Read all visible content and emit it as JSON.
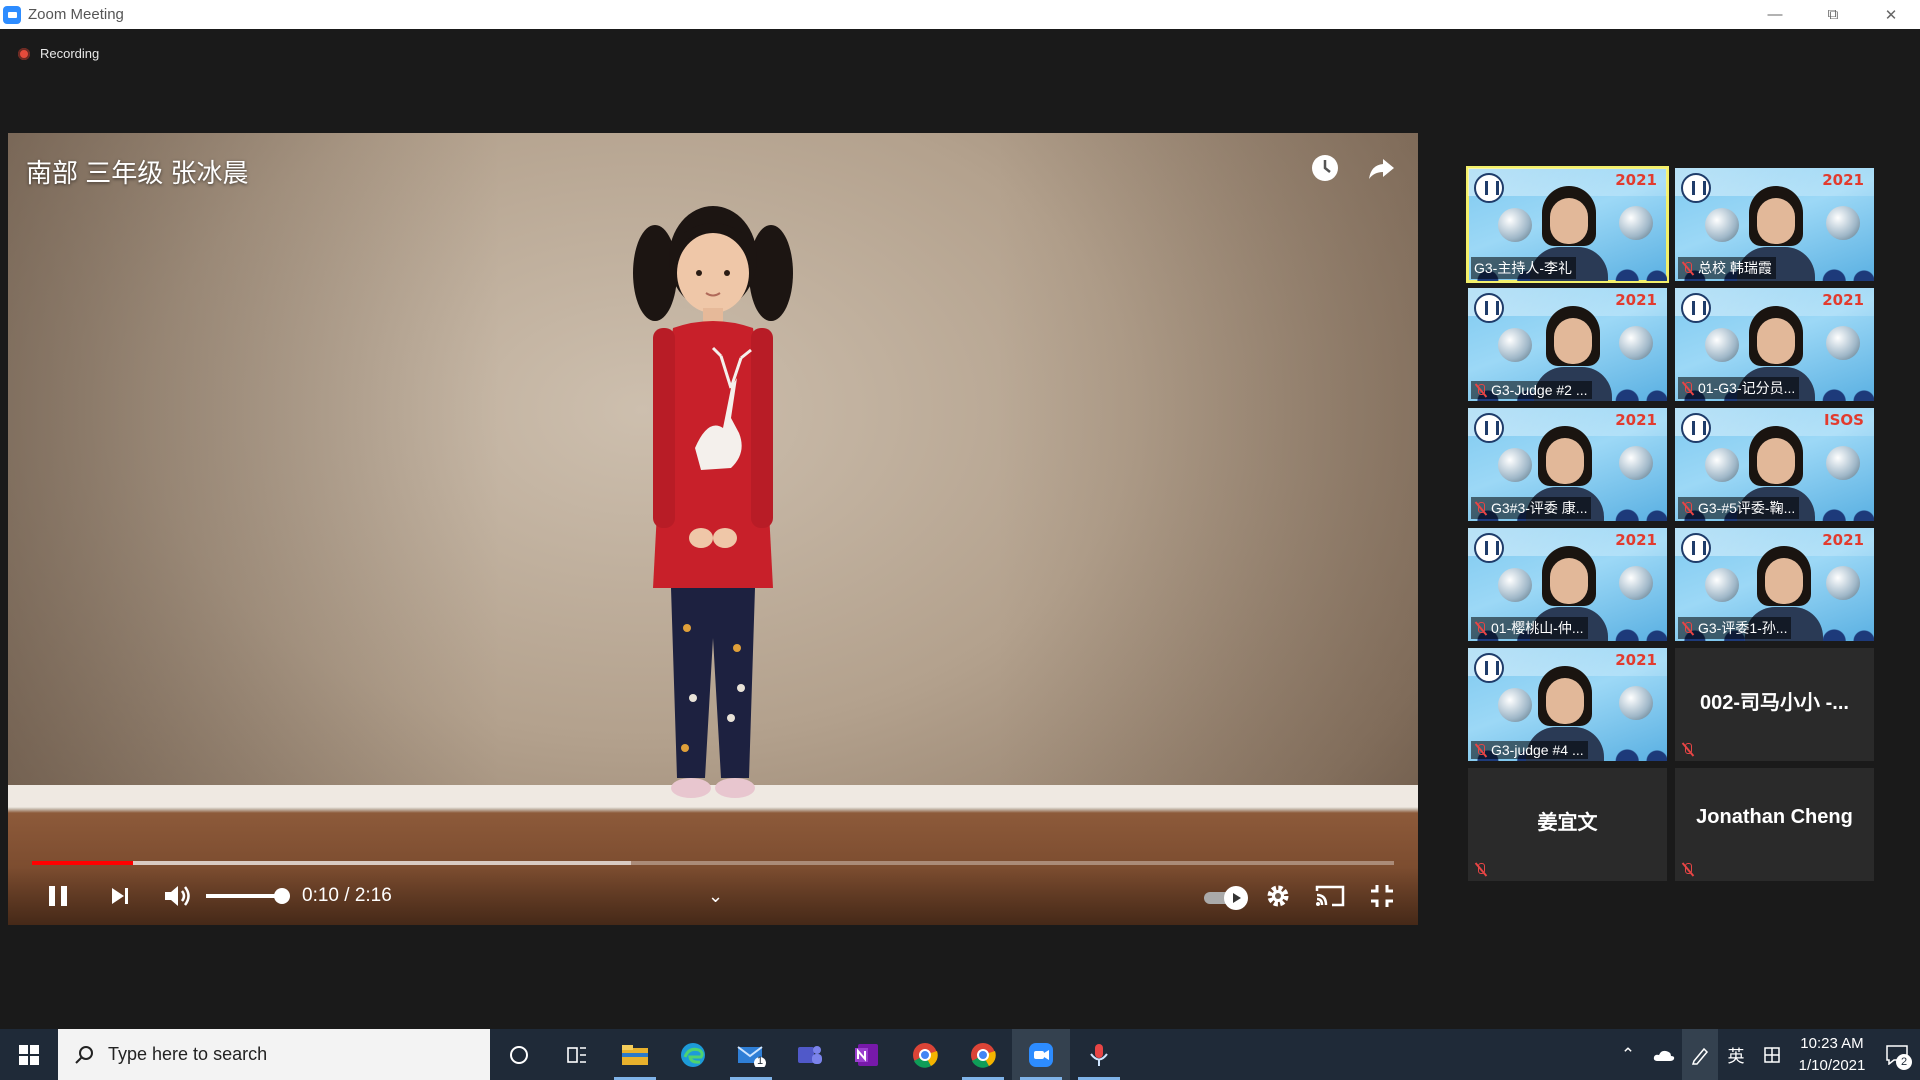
{
  "window": {
    "title": "Zoom Meeting"
  },
  "meeting": {
    "recording_label": "Recording"
  },
  "video": {
    "title": "南部 三年级 张冰晨",
    "time_current": "0:10",
    "time_total": "2:16",
    "time_separator": " / ",
    "progress_played": 0.074,
    "progress_loaded": 0.44,
    "volume_level": 1.0,
    "autoplay_on": true
  },
  "participants": [
    {
      "name": "G3-主持人-李礼",
      "has_video": true,
      "active_speaker": true,
      "muted": false,
      "banner_year": "2021"
    },
    {
      "name": "总校 韩瑞霞",
      "has_video": true,
      "active_speaker": false,
      "muted": true,
      "banner_year": "2021"
    },
    {
      "name": "G3-Judge #2 ...",
      "has_video": true,
      "active_speaker": false,
      "muted": true,
      "banner_year": "2021"
    },
    {
      "name": "01-G3-记分员...",
      "has_video": true,
      "active_speaker": false,
      "muted": true,
      "banner_year": "2021"
    },
    {
      "name": "G3#3-评委 康...",
      "has_video": true,
      "active_speaker": false,
      "muted": true,
      "banner_year": "2021"
    },
    {
      "name": "G3-#5评委-鞠...",
      "has_video": true,
      "active_speaker": false,
      "muted": true,
      "banner_year": "ISOS"
    },
    {
      "name": "01-樱桃山-仲...",
      "has_video": true,
      "active_speaker": false,
      "muted": true,
      "banner_year": "2021"
    },
    {
      "name": "G3-评委1-孙...",
      "has_video": true,
      "active_speaker": false,
      "muted": true,
      "banner_year": "2021"
    },
    {
      "name": "G3-judge #4 ...",
      "has_video": true,
      "active_speaker": false,
      "muted": true,
      "banner_year": "2021"
    },
    {
      "name": "002-司马小小 -...",
      "has_video": false,
      "active_speaker": false,
      "muted": true
    },
    {
      "name": "姜宜文",
      "has_video": false,
      "active_speaker": false,
      "muted": true
    },
    {
      "name": "Jonathan Cheng",
      "has_video": false,
      "active_speaker": false,
      "muted": true
    }
  ],
  "taskbar": {
    "search_placeholder": "Type here to search",
    "mail_badge": "1",
    "ime_label": "英",
    "clock_time": "10:23 AM",
    "clock_date": "1/10/2021",
    "notification_count": "2"
  },
  "colors": {
    "zoom_blue": "#2d8cff",
    "active_speaker_outline": "#f3f06a",
    "youtube_red": "#ff0000",
    "taskbar_bg": "#1f2a38"
  }
}
